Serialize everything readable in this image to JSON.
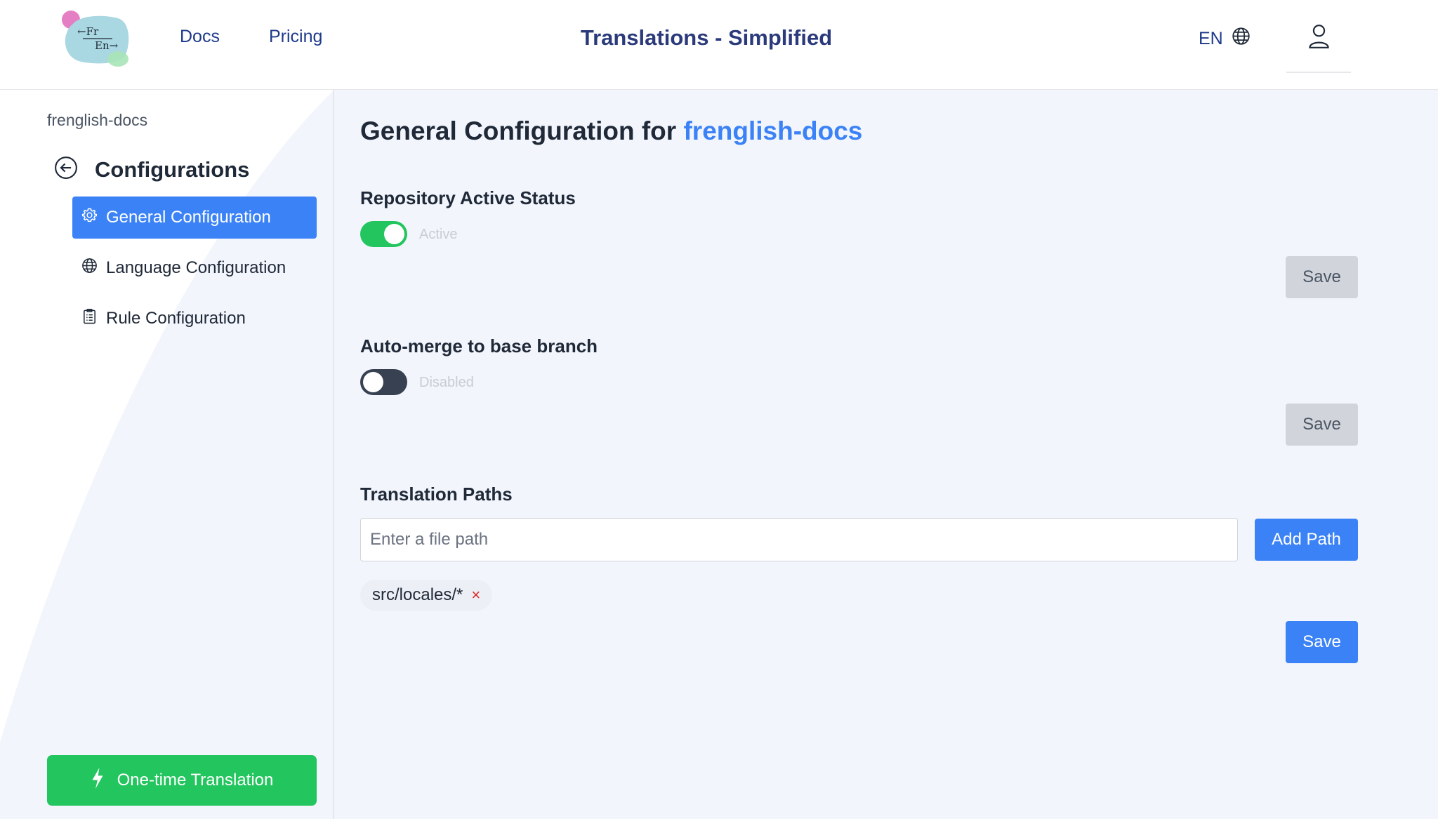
{
  "header": {
    "logo": {
      "top_text": "←Fr",
      "bottom_text": "En→"
    },
    "nav": [
      {
        "label": "Docs"
      },
      {
        "label": "Pricing"
      }
    ],
    "title": "Translations - Simplified",
    "language": "EN",
    "icons": {
      "language": "globe-icon",
      "account": "user-icon"
    }
  },
  "sidebar": {
    "repo_name": "frenglish-docs",
    "section_title": "Configurations",
    "back_icon": "arrow-left-circle-icon",
    "items": [
      {
        "label": "General Configuration",
        "icon": "gear-icon",
        "active": true
      },
      {
        "label": "Language Configuration",
        "icon": "globe-icon",
        "active": false
      },
      {
        "label": "Rule Configuration",
        "icon": "clipboard-list-icon",
        "active": false
      }
    ],
    "one_time_button": {
      "label": "One-time Translation",
      "icon": "lightning-icon"
    }
  },
  "main": {
    "title_prefix": "General Configuration for",
    "title_repo": "frenglish-docs",
    "active_status": {
      "label": "Repository Active Status",
      "enabled": true,
      "state_text": "Active",
      "save_label": "Save"
    },
    "auto_merge": {
      "label": "Auto-merge to base branch",
      "enabled": false,
      "state_text": "Disabled",
      "save_label": "Save"
    },
    "translation_paths": {
      "label": "Translation Paths",
      "input_placeholder": "Enter a file path",
      "input_value": "",
      "add_label": "Add Path",
      "paths": [
        "src/locales/*"
      ],
      "remove_symbol": "×",
      "save_label": "Save"
    }
  },
  "colors": {
    "primary": "#3b82f6",
    "success": "#22c55e",
    "danger": "#dc2626",
    "title_navy": "#2b3a7a",
    "main_bg": "#f2f5fc"
  }
}
